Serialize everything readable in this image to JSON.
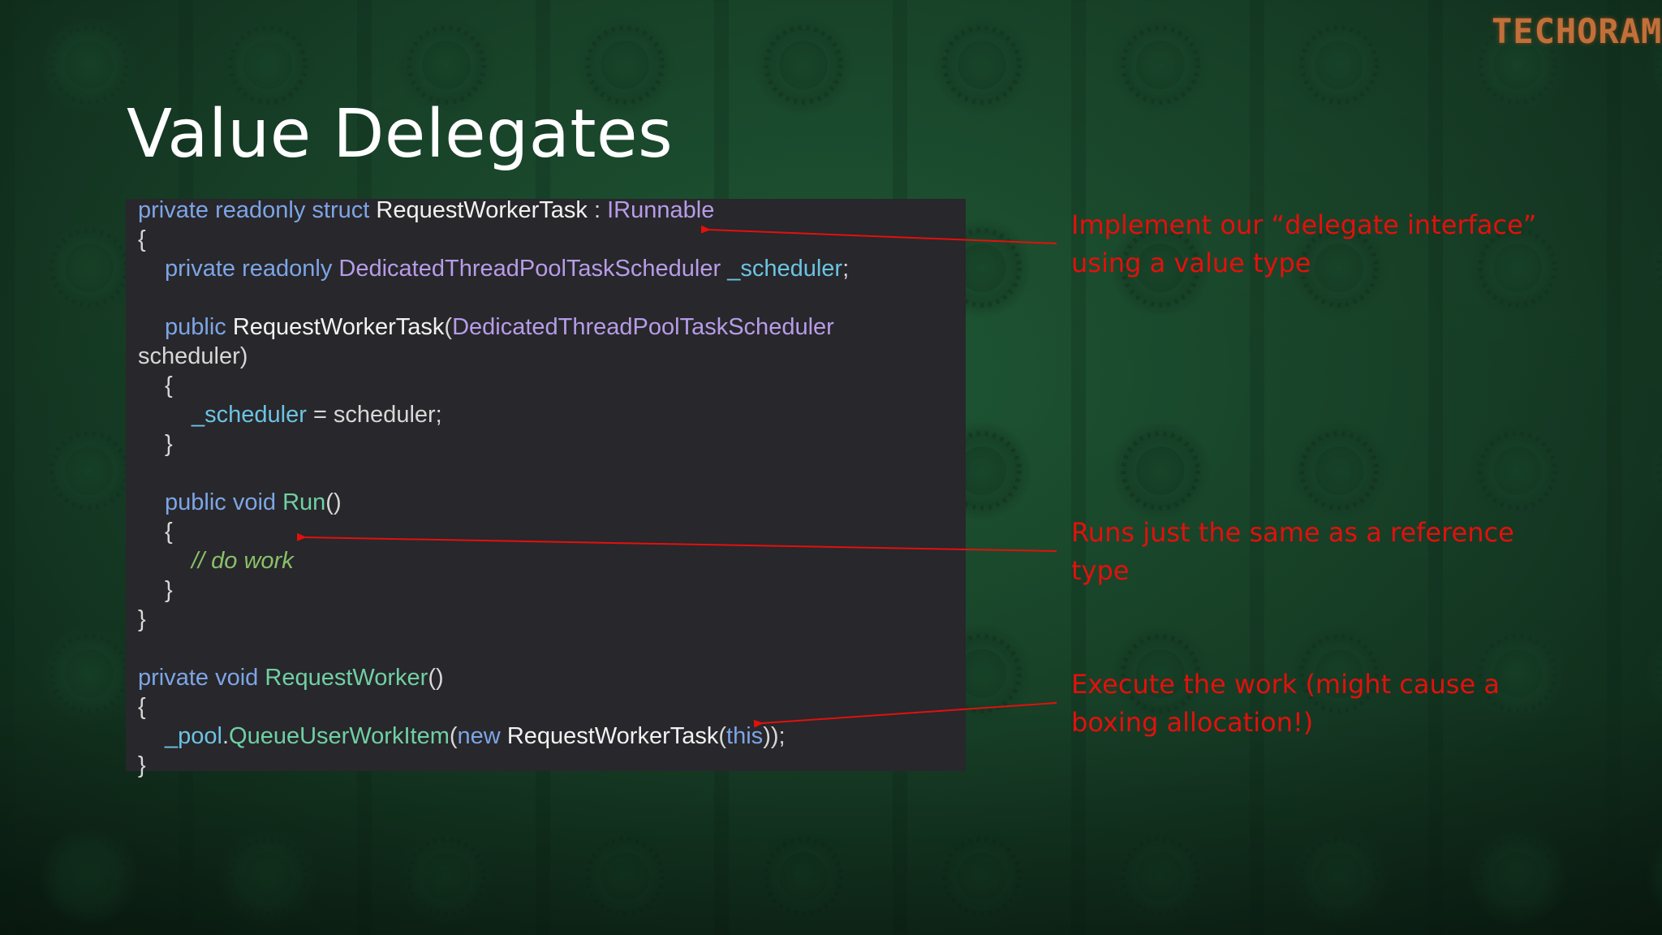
{
  "logo": {
    "text": "TECHORAMA"
  },
  "slide": {
    "title": "Value Delegates"
  },
  "code": {
    "l1": {
      "kw": "private readonly struct",
      "name": "RequestWorkerTask",
      "sep": ":",
      "iface": "IRunnable"
    },
    "l2": {
      "text": "{"
    },
    "l3": {
      "kw": "private readonly",
      "type": "DedicatedThreadPoolTaskScheduler",
      "field": "_scheduler",
      "end": ";"
    },
    "l4": {
      "kw": "public",
      "name": "RequestWorkerTask",
      "open": "(",
      "type": "DedicatedThreadPoolTaskScheduler"
    },
    "l5": {
      "text": "scheduler)"
    },
    "l6": {
      "text": "{"
    },
    "l7": {
      "field": "_scheduler",
      "rest": "= scheduler;"
    },
    "l8": {
      "text": "}"
    },
    "l9": {
      "kw": "public void",
      "method": "Run",
      "parens": "()"
    },
    "l10": {
      "text": "{"
    },
    "l11": {
      "comment": "// do work"
    },
    "l12": {
      "text": "}"
    },
    "l13": {
      "text": "}"
    },
    "l14": {
      "kw": "private void",
      "method": "RequestWorker",
      "parens": "()"
    },
    "l15": {
      "text": "{"
    },
    "l16": {
      "field": "_pool",
      "dot": ".",
      "method": "QueueUserWorkItem",
      "open": "(",
      "kw": "new",
      "name": "RequestWorkerTask",
      "open2": "(",
      "kw2": "this",
      "end": "));"
    },
    "l17": {
      "text": "}"
    }
  },
  "annotations": {
    "a1": "Implement our “delegate interface” using a value type",
    "a2": "Runs just the same as a reference type",
    "a3": "Execute the work (might cause a boxing allocation!)"
  },
  "colors": {
    "background": "#173f27",
    "code_background": "#28272b",
    "annotation": "#e3100c",
    "keyword": "#7da5e6",
    "interface": "#b79ce8",
    "field": "#6cc3e3",
    "method": "#6fd0a4",
    "comment": "#89c06a"
  }
}
